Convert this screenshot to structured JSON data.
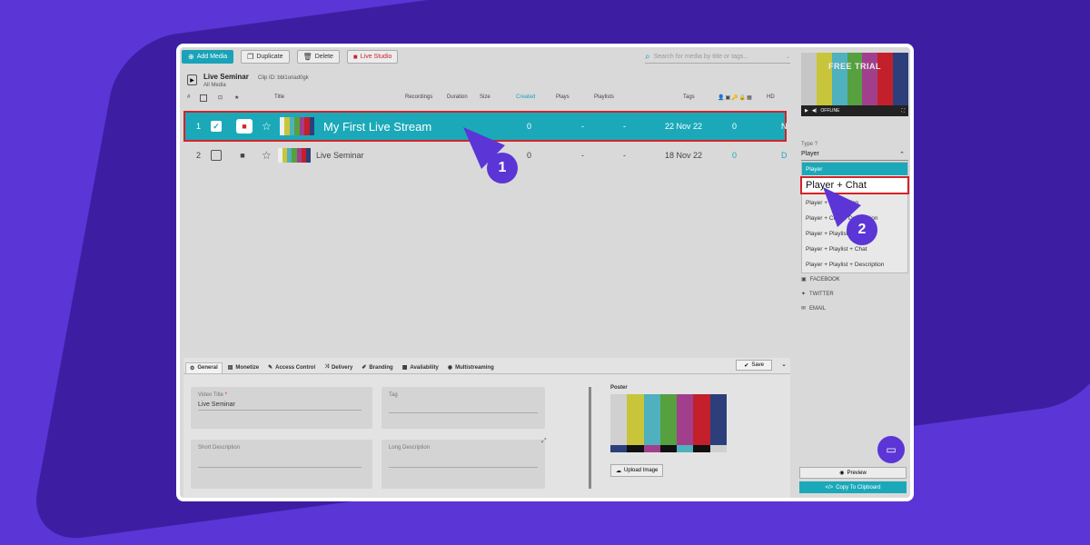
{
  "toolbar": {
    "add_media": "Add Media",
    "duplicate": "Duplicate",
    "delete": "Delete",
    "live_studio": "Live Studio",
    "search_placeholder": "Search for media by title or tags..."
  },
  "header": {
    "title": "Live Seminar",
    "clip_id": "Clip ID: bbl1oriad0gk",
    "subtitle": "All Media"
  },
  "columns": {
    "num": "#",
    "title": "Title",
    "recordings": "Recordings",
    "duration": "Duration",
    "size": "Size",
    "created": "Created",
    "plays": "Plays",
    "playlists": "Playlists",
    "tags": "Tags",
    "hd": "HD"
  },
  "rows": [
    {
      "num": "1",
      "title": "My First Live Stream",
      "recordings": "0",
      "plays": "-",
      "playlists": "-",
      "created": "22 Nov 22",
      "tags": "0",
      "extra": "N"
    },
    {
      "num": "2",
      "title": "Live Seminar",
      "recordings": "0",
      "plays": "-",
      "playlists": "-",
      "created": "18 Nov 22",
      "tags": "0",
      "extra": "D"
    }
  ],
  "tabs": [
    "General",
    "Monetize",
    "Access Control",
    "Delivery",
    "Branding",
    "Availability",
    "Multistreaming"
  ],
  "save_label": "Save",
  "form": {
    "video_title_label": "Video Title",
    "video_title_value": "Live Seminar",
    "tag_label": "Tag",
    "short_desc_label": "Short Description",
    "long_desc_label": "Long Description",
    "poster_label": "Poster",
    "upload_label": "Upload Image"
  },
  "player": {
    "free_trial": "FREE TRIAL",
    "offline": "OFFLINE"
  },
  "type_panel": {
    "label": "Type",
    "value": "Player",
    "options": [
      "Player",
      "Player + Chat",
      "Player + Description",
      "Player + Chat + Description",
      "Player + Playlist",
      "Player + Playlist + Chat",
      "Player + Playlist + Description"
    ]
  },
  "share": {
    "facebook": "FACEBOOK",
    "twitter": "TWITTER",
    "email": "EMAIL"
  },
  "preview_label": "Preview",
  "copy_label": "Copy To Clipboard",
  "callouts": {
    "one": "1",
    "two": "2"
  },
  "colors": {
    "accent": "#1ba9b9",
    "highlight": "#d2232a",
    "brand": "#5b35d6"
  }
}
